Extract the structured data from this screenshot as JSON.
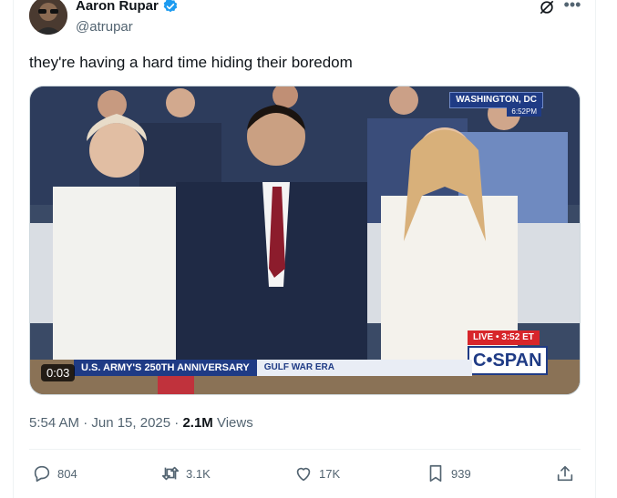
{
  "author": {
    "name": "Aaron Rupar",
    "handle": "@atrupar",
    "verified": true
  },
  "tweet": {
    "text": "they're having a hard time hiding their boredom",
    "timestamp": "5:54 AM · Jun 15, 2025 ·",
    "views_count": "2.1M",
    "views_label": "Views"
  },
  "video": {
    "duration": "0:03",
    "location": "WASHINGTON, DC",
    "location_time": "6:52PM",
    "live_label": "LIVE • 3:52 ET",
    "lower_third_main": "U.S. ARMY'S 250TH ANNIVERSARY",
    "lower_third_sub": "GULF WAR ERA",
    "network": "C•SPAN"
  },
  "actions": {
    "replies": "804",
    "reposts": "3.1K",
    "likes": "17K",
    "bookmarks": "939"
  },
  "colors": {
    "accent": "#1d9bf0",
    "secondary_text": "#536471",
    "cspan_blue": "#1f3b85",
    "live_red": "#d7262b"
  }
}
